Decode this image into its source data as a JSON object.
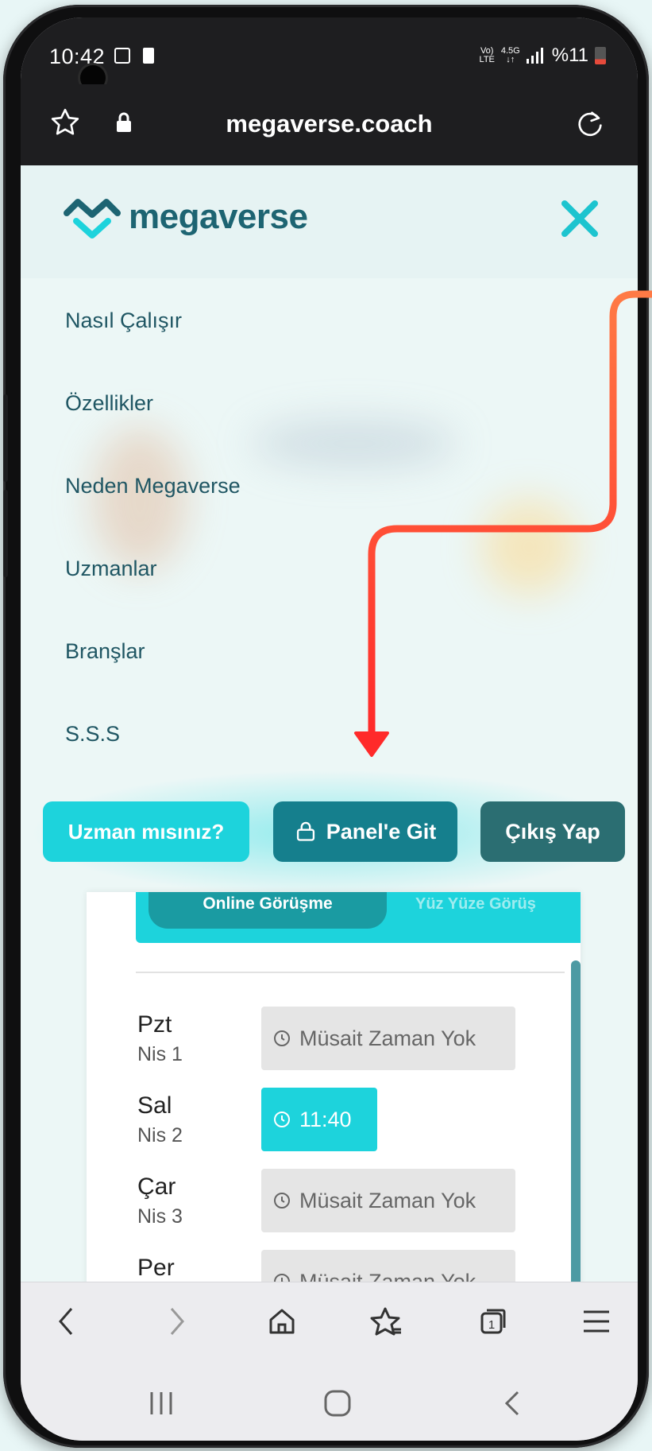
{
  "status_bar": {
    "time": "10:42",
    "network": "VoLTE",
    "net_speed": "4.5G",
    "battery": "%11",
    "battery_percent": 11
  },
  "browser": {
    "url": "megaverse.coach",
    "bookmark_icon": "star-icon",
    "lock_icon": "lock-icon",
    "reload_icon": "reload-icon"
  },
  "site": {
    "logo_text": "megaverse",
    "logo_color": "#1d6472",
    "accent_color": "#1dd3dc",
    "menu": [
      {
        "label": "Nasıl Çalışır"
      },
      {
        "label": "Özellikler"
      },
      {
        "label": "Neden Megaverse"
      },
      {
        "label": "Uzmanlar"
      },
      {
        "label": "Branşlar"
      },
      {
        "label": "S.S.S"
      }
    ],
    "buttons": {
      "expert": "Uzman mısınız?",
      "panel": "Panel'e Git",
      "logout": "Çıkış Yap"
    }
  },
  "schedule": {
    "tabs": {
      "active": "Online Görüşme",
      "other": "Yüz Yüze Görüş"
    },
    "days": [
      {
        "name": "Pzt",
        "date": "Nis 1",
        "slot": "Müsait Zaman Yok",
        "available": false
      },
      {
        "name": "Sal",
        "date": "Nis 2",
        "slot": "11:40",
        "available": true
      },
      {
        "name": "Çar",
        "date": "Nis 3",
        "slot": "Müsait Zaman Yok",
        "available": false
      },
      {
        "name": "Per",
        "date": "",
        "slot": "Müsait Zaman Yok",
        "available": false
      }
    ]
  },
  "annotation": {
    "arrow_color_start": "#ff6a3d",
    "arrow_color_end": "#ff2a2a"
  },
  "browser_nav": [
    "back-icon",
    "forward-icon",
    "home-icon",
    "bookmarks-icon",
    "tabs-icon",
    "menu-icon"
  ],
  "browser_nav_tabs_count": "1",
  "system_nav": [
    "recents-icon",
    "home-button-icon",
    "system-back-icon"
  ]
}
